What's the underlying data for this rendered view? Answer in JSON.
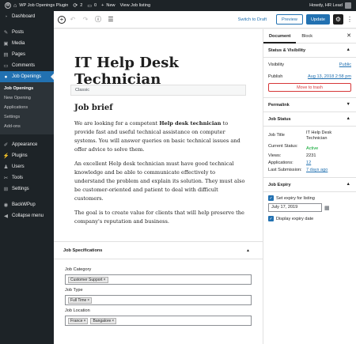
{
  "adminbar": {
    "site_name": "WP Job Openings Plugin",
    "updates_count": "2",
    "comments_count": "0",
    "new_label": "New",
    "view_label": "View Job listing",
    "howdy": "Howdy, HR Lead"
  },
  "sidebar": {
    "items": [
      {
        "label": "Dashboard",
        "icon": "dashboard-icon"
      },
      {
        "label": "Posts",
        "icon": "pin-icon"
      },
      {
        "label": "Media",
        "icon": "media-icon"
      },
      {
        "label": "Pages",
        "icon": "pages-icon"
      },
      {
        "label": "Comments",
        "icon": "comment-icon"
      },
      {
        "label": "Job Openings",
        "icon": "briefcase-icon"
      },
      {
        "label": "Appearance",
        "icon": "brush-icon"
      },
      {
        "label": "Plugins",
        "icon": "plugin-icon"
      },
      {
        "label": "Users",
        "icon": "user-icon"
      },
      {
        "label": "Tools",
        "icon": "wrench-icon"
      },
      {
        "label": "Settings",
        "icon": "settings-icon"
      },
      {
        "label": "BackWPup",
        "icon": "backup-icon"
      },
      {
        "label": "Collapse menu",
        "icon": "collapse-icon"
      }
    ],
    "submenu": [
      "Job Openings",
      "New Opening",
      "Applications",
      "Settings",
      "Add-ons"
    ]
  },
  "toolbar": {
    "switch_draft": "Switch to Draft",
    "preview": "Preview",
    "update": "Update"
  },
  "editor": {
    "title": "IT Help Desk Technician",
    "classic_label": "Classic",
    "heading": "Job brief",
    "p1_before": "We are looking for a competent ",
    "p1_bold": "Help desk technician",
    "p1_after": " to provide fast and useful technical assistance on computer systems. You will answer queries on basic technical issues and offer advice to solve them.",
    "p2": "An excellent Help desk technician must have good technical knowledge and be able to communicate effectively to understand the problem and explain its solution. They must also be customer-oriented and patient to deal with difficult customers.",
    "p3": "The goal is to create value for clients that will help preserve the company's reputation and business."
  },
  "job_specs": {
    "title": "Job Specifications",
    "category_label": "Job Category",
    "category_tags": [
      "Customer Support"
    ],
    "type_label": "Job Type",
    "type_tags": [
      "Full Time"
    ],
    "location_label": "Job Location",
    "location_tags": [
      "France",
      "Bangalore"
    ]
  },
  "settings_panel": {
    "tab_document": "Document",
    "tab_block": "Block",
    "status_visibility": {
      "title": "Status & Visibility",
      "visibility_label": "Visibility",
      "visibility_value": "Public",
      "publish_label": "Publish",
      "publish_value": "Aug 13, 2018 2:58 pm",
      "trash_label": "Move to trash"
    },
    "permalink_title": "Permalink",
    "job_status": {
      "title": "Job Status",
      "job_title_label": "Job Title",
      "job_title_value": "IT Help Desk Technician",
      "current_status_label": "Current Status:",
      "current_status_value": "Active",
      "views_label": "Views:",
      "views_value": "2231",
      "applications_label": "Applications:",
      "applications_value": "12",
      "last_submission_label": "Last Submission:",
      "last_submission_value": "7 days ago"
    },
    "job_expiry": {
      "title": "Job Expiry",
      "set_expiry_label": "Set expiry for listing",
      "expiry_date": "July 17, 2019",
      "display_expiry_label": "Display expiry date"
    }
  }
}
